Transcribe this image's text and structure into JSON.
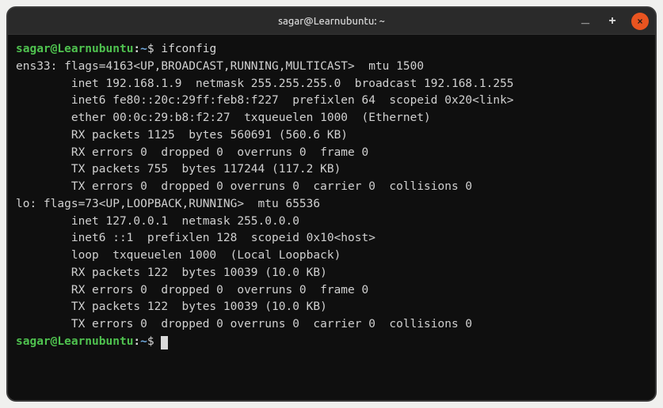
{
  "window": {
    "title": "sagar@Learnubuntu: ~",
    "controls": {
      "min": "_",
      "max": "+",
      "close": "×"
    }
  },
  "prompt": {
    "user": "sagar",
    "at": "@",
    "host": "Learnubuntu",
    "colon": ":",
    "path": "~",
    "dollar": "$"
  },
  "session": {
    "command": "ifconfig",
    "output": [
      "ens33: flags=4163<UP,BROADCAST,RUNNING,MULTICAST>  mtu 1500",
      "        inet 192.168.1.9  netmask 255.255.255.0  broadcast 192.168.1.255",
      "        inet6 fe80::20c:29ff:feb8:f227  prefixlen 64  scopeid 0x20<link>",
      "        ether 00:0c:29:b8:f2:27  txqueuelen 1000  (Ethernet)",
      "        RX packets 1125  bytes 560691 (560.6 KB)",
      "        RX errors 0  dropped 0  overruns 0  frame 0",
      "        TX packets 755  bytes 117244 (117.2 KB)",
      "        TX errors 0  dropped 0 overruns 0  carrier 0  collisions 0",
      "",
      "lo: flags=73<UP,LOOPBACK,RUNNING>  mtu 65536",
      "        inet 127.0.0.1  netmask 255.0.0.0",
      "        inet6 ::1  prefixlen 128  scopeid 0x10<host>",
      "        loop  txqueuelen 1000  (Local Loopback)",
      "        RX packets 122  bytes 10039 (10.0 KB)",
      "        RX errors 0  dropped 0  overruns 0  frame 0",
      "        TX packets 122  bytes 10039 (10.0 KB)",
      "        TX errors 0  dropped 0 overruns 0  carrier 0  collisions 0",
      ""
    ]
  }
}
